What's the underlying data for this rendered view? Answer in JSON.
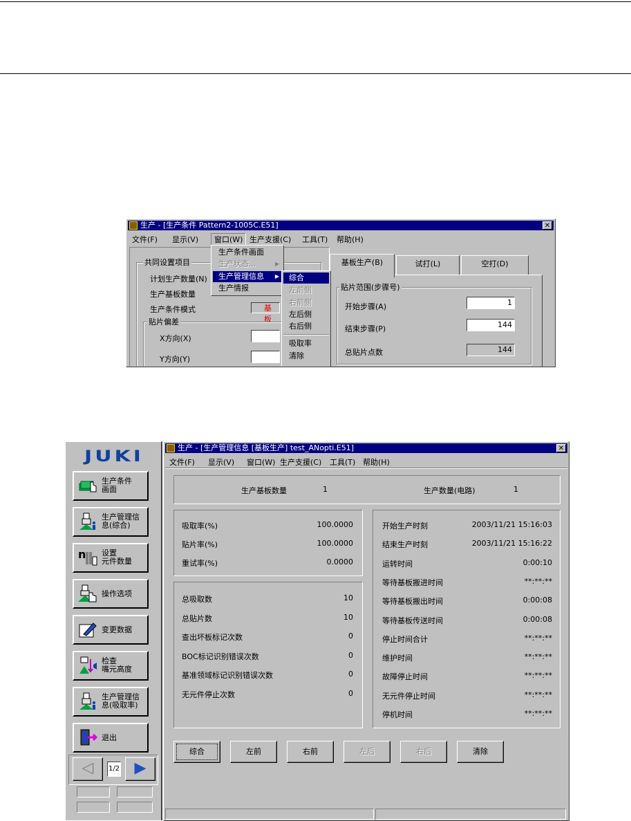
{
  "win1": {
    "title": "生产 - [生产条件 Pattern2-1005C.E51]",
    "close": "✕",
    "menu": [
      "文件(F)",
      "显示(V)",
      "窗口(W)",
      "生产支援(C)",
      "工具(T)",
      "帮助(H)"
    ],
    "common_group": "共同设置项目",
    "plan_qty_label": "计划生产数量(N)",
    "board_qty_label": "生产基板数量",
    "mode_label": "生产条件模式",
    "mode_value": "基板",
    "offset_group": "贴片偏差",
    "x_label": "X方向(X)",
    "y_label": "Y方向(Y)",
    "tabs": [
      "基板生产(B)",
      "试打(L)",
      "空打(D)"
    ],
    "range_group": "贴片范围(步骤号)",
    "start_label": "开始步骤(A)",
    "start_value": "1",
    "end_label": "结束步骤(P)",
    "end_value": "144",
    "total_label": "总贴片点数",
    "total_value": "144",
    "window_menu": [
      "生产条件画面",
      "生产状态...",
      "生产管理信息",
      "生产情报"
    ],
    "submenu": [
      "综合",
      "左前侧",
      "右前侧",
      "左后侧",
      "右后侧",
      "吸取率",
      "清除"
    ]
  },
  "sidebar": {
    "logo": "JUKI",
    "buttons": [
      "生产条件\n画面",
      "生产管理信\n息(综合)",
      "设置\n元件数量",
      "操作选项",
      "变更数据",
      "检查\n嘴元高度",
      "生产管理信\n息(吸取率)",
      "退出"
    ],
    "page": "1/2"
  },
  "win2": {
    "title": "生产 - [生产管理信息 [基板生产] test_ANopti.E51]",
    "close": "✕",
    "menu": [
      "文件(F)",
      "显示(V)",
      "窗口(W)",
      "生产支援(C)",
      "工具(T)",
      "帮助(H)"
    ],
    "board_qty_label": "生产基板数量",
    "board_qty_value": "1",
    "prod_qty_label": "生产数量(电路)",
    "prod_qty_value": "1",
    "rates": [
      {
        "label": "吸取率(%)",
        "value": "100.0000"
      },
      {
        "label": "贴片率(%)",
        "value": "100.0000"
      },
      {
        "label": "重试率(%)",
        "value": "0.0000"
      }
    ],
    "counts": [
      {
        "label": "总吸取数",
        "value": "10"
      },
      {
        "label": "总贴片数",
        "value": "10"
      },
      {
        "label": "查出坏板标记次数",
        "value": "0"
      },
      {
        "label": "BOC标记识别错误次数",
        "value": "0"
      },
      {
        "label": "基准领域标记识别错误次数",
        "value": "0"
      },
      {
        "label": "无元件停止次数",
        "value": "0"
      }
    ],
    "times": [
      {
        "label": "开始生产时刻",
        "value": "2003/11/21 15:16:03"
      },
      {
        "label": "结束生产时刻",
        "value": "2003/11/21 15:16:22"
      },
      {
        "label": "运转时间",
        "value": "0:00:10"
      },
      {
        "label": "等待基板搬进时间",
        "value": "**:**:**"
      },
      {
        "label": "等待基板搬出时间",
        "value": "0:00:08"
      },
      {
        "label": "等待基板传送时间",
        "value": "0:00:08"
      },
      {
        "label": "停止时间合计",
        "value": "**:**:**"
      },
      {
        "label": "维护时间",
        "value": "**:**:**"
      },
      {
        "label": "故障停止时间",
        "value": "**:**:**"
      },
      {
        "label": "无元件停止时间",
        "value": "**:**:**"
      },
      {
        "label": "停机时间",
        "value": "**:**:**"
      }
    ],
    "buttons": [
      "综合",
      "左前",
      "右前",
      "左后",
      "右后",
      "清除"
    ]
  }
}
